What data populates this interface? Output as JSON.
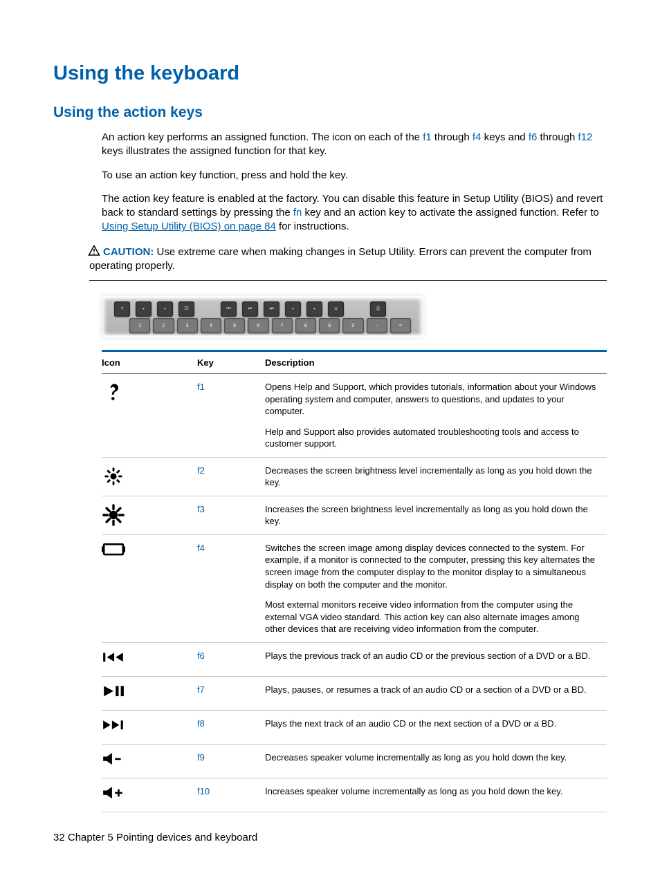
{
  "heading1": "Using the keyboard",
  "heading2": "Using the action keys",
  "para1": {
    "t1": "An action key performs an assigned function. The icon on each of the ",
    "k1": "f1",
    "t2": " through ",
    "k2": "f4",
    "t3": " keys and ",
    "k3": "f6",
    "t4": " through ",
    "k4": "f12",
    "t5": " keys illustrates the assigned function for that key."
  },
  "para2": "To use an action key function, press and hold the key.",
  "para3": {
    "t1": "The action key feature is enabled at the factory. You can disable this feature in Setup Utility (BIOS) and revert back to standard settings by pressing the ",
    "k1": "fn",
    "t2": " key and an action key to activate the assigned function. Refer to ",
    "link": "Using Setup Utility (BIOS) on page 84",
    "t3": " for instructions."
  },
  "caution": {
    "label": "CAUTION:",
    "text": "   Use extreme care when making changes in Setup Utility. Errors can prevent the computer from operating properly."
  },
  "table": {
    "headers": {
      "icon": "Icon",
      "key": "Key",
      "desc": "Description"
    },
    "rows": [
      {
        "icon": "help-icon",
        "key": "f1",
        "desc": [
          "Opens Help and Support, which provides tutorials, information about your Windows operating system and computer, answers to questions, and updates to your computer.",
          "Help and Support also provides automated troubleshooting tools and access to customer support."
        ]
      },
      {
        "icon": "brightness-down-icon",
        "key": "f2",
        "desc": [
          "Decreases the screen brightness level incrementally as long as you hold down the key."
        ]
      },
      {
        "icon": "brightness-up-icon",
        "key": "f3",
        "desc": [
          "Increases the screen brightness level incrementally as long as you hold down the key."
        ]
      },
      {
        "icon": "switch-display-icon",
        "key": "f4",
        "desc": [
          "Switches the screen image among display devices connected to the system. For example, if a monitor is connected to the computer, pressing this key alternates the screen image from the computer display to the monitor display to a simultaneous display on both the computer and the monitor.",
          "Most external monitors receive video information from the computer using the external VGA video standard. This action key can also alternate images among other devices that are receiving video information from the computer."
        ]
      },
      {
        "icon": "prev-track-icon",
        "key": "f6",
        "desc": [
          "Plays the previous track of an audio CD or the previous section of a DVD or a BD."
        ]
      },
      {
        "icon": "play-pause-icon",
        "key": "f7",
        "desc": [
          "Plays, pauses, or resumes a track of an audio CD or a section of a DVD or a BD."
        ]
      },
      {
        "icon": "next-track-icon",
        "key": "f8",
        "desc": [
          "Plays the next track of an audio CD or the next section of a DVD or a BD."
        ]
      },
      {
        "icon": "volume-down-icon",
        "key": "f9",
        "desc": [
          "Decreases speaker volume incrementally as long as you hold down the key."
        ]
      },
      {
        "icon": "volume-up-icon",
        "key": "f10",
        "desc": [
          "Increases speaker volume incrementally as long as you hold down the key."
        ]
      }
    ]
  },
  "footer": {
    "page": "32",
    "sep": "   ",
    "chapter": "Chapter 5   Pointing devices and keyboard"
  },
  "icons_svg": {
    "help-icon": "<svg viewBox='0 0 24 24' fill='#000'><path d='M9 7a4 4 0 1 1 5.6 3.7c-1.2.7-2.1 1.3-2.1 2.8v.5h-2v-.5c0-2.5 1.6-3.4 2.7-4.1A2 2 0 1 0 10 7H9z'/><circle cx='11.5' cy='18' r='1.6'/></svg>",
    "brightness-down-icon": "<svg viewBox='0 0 24 24' fill='none' stroke='#000' stroke-width='2'><circle cx='12' cy='12' r='2.2' fill='#000'/><g stroke-linecap='round'><line x1='12' y1='4' x2='12' y2='6'/><line x1='12' y1='18' x2='12' y2='20'/><line x1='4' y1='12' x2='6' y2='12'/><line x1='18' y1='12' x2='20' y2='12'/><line x1='6.5' y1='6.5' x2='8' y2='8'/><line x1='16' y1='16' x2='17.5' y2='17.5'/><line x1='6.5' y1='17.5' x2='8' y2='16'/><line x1='16' y1='8' x2='17.5' y2='6.5'/></g></svg>",
    "brightness-up-icon": "<svg viewBox='0 0 24 24' fill='none' stroke='#000' stroke-width='2.4'><circle cx='12' cy='12' r='3.2' fill='#000'/><g stroke-linecap='round'><line x1='12' y1='2' x2='12' y2='6'/><line x1='12' y1='18' x2='12' y2='22'/><line x1='2' y1='12' x2='6' y2='12'/><line x1='18' y1='12' x2='22' y2='12'/><line x1='5' y1='5' x2='8' y2='8'/><line x1='16' y1='16' x2='19' y2='19'/><line x1='5' y1='19' x2='8' y2='16'/><line x1='16' y1='8' x2='19' y2='5'/></g></svg>",
    "switch-display-icon": "<svg viewBox='0 0 32 20' fill='none' stroke='#000' stroke-width='2.5'><rect x='3' y='3' width='26' height='14' rx='1'/><rect x='0' y='6' width='3' height='8' fill='#000' stroke='none'/><rect x='29' y='6' width='3' height='8' fill='#000' stroke='none'/></svg>",
    "prev-track-icon": "<svg viewBox='0 0 32 20' fill='#000'><rect x='2' y='4' width='3' height='12'/><polygon points='17,4 7,10 17,16'/><polygon points='29,4 19,10 29,16'/></svg>",
    "play-pause-icon": "<svg viewBox='0 0 32 20' fill='#000'><polygon points='3,3 16,10 3,17'/><rect x='19' y='3' width='4' height='14'/><rect x='26' y='3' width='4' height='14'/></svg>",
    "next-track-icon": "<svg viewBox='0 0 32 20' fill='#000'><polygon points='2,4 12,10 2,16'/><polygon points='14,4 24,10 14,16'/><rect x='26' y='4' width='3' height='12'/></svg>",
    "volume-down-icon": "<svg viewBox='0 0 32 20' fill='#000'><rect x='2' y='7' width='5' height='6'/><polygon points='7,7 14,2 14,18 7,13'/><rect x='18' y='9' width='8' height='2.5'/></svg>",
    "volume-up-icon": "<svg viewBox='0 0 32 20' fill='#000'><rect x='2' y='7' width='5' height='6'/><polygon points='7,7 14,2 14,18 7,13'/><rect x='18' y='9' width='10' height='2.5'/><rect x='21.75' y='5.25' width='2.5' height='10'/></svg>",
    "caution-triangle": "<svg viewBox='0 0 24 22' fill='none' stroke='#000' stroke-width='2'><polygon points='12,2 22,20 2,20'/><line x1='12' y1='8' x2='12' y2='14'/><circle cx='12' cy='17' r='1' fill='#000' stroke='none'/></svg>"
  }
}
